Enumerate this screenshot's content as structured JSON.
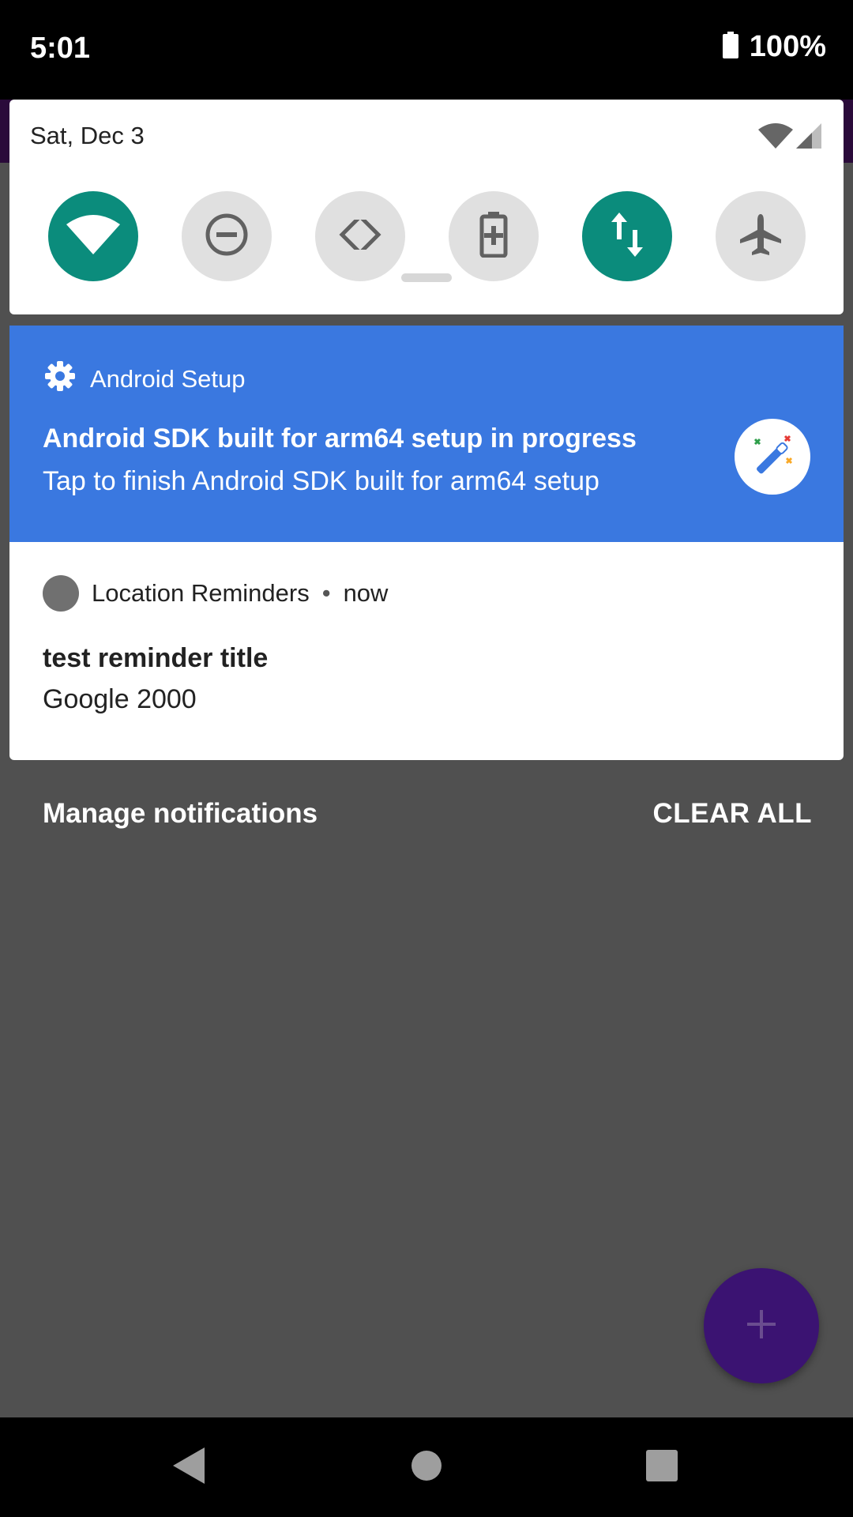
{
  "status_bar": {
    "time": "5:01",
    "battery_percent": "100%",
    "icons": [
      "battery-icon"
    ]
  },
  "quick_settings": {
    "date": "Sat, Dec 3",
    "status_icons": [
      "wifi-icon",
      "cell-signal-icon"
    ],
    "tiles": [
      {
        "name": "wifi",
        "icon": "wifi-icon",
        "active": true
      },
      {
        "name": "do-not-disturb",
        "icon": "do-not-disturb-icon",
        "active": false
      },
      {
        "name": "auto-rotate",
        "icon": "auto-rotate-icon",
        "active": false
      },
      {
        "name": "battery-saver",
        "icon": "battery-saver-icon",
        "active": false
      },
      {
        "name": "mobile-data",
        "icon": "mobile-data-icon",
        "active": true
      },
      {
        "name": "airplane-mode",
        "icon": "airplane-icon",
        "active": false
      }
    ],
    "colors": {
      "tile_on": "#0b8c7c",
      "tile_off": "#e0e0e0"
    }
  },
  "notifications": {
    "setup": {
      "app_name": "Android Setup",
      "title": "Android SDK built for arm64 setup in progress",
      "text": "Tap to finish Android SDK built for arm64 setup",
      "icon": "gear-icon",
      "avatar_icon": "magic-wand-icon",
      "background": "#3a78e0"
    },
    "reminder": {
      "app_name": "Location Reminders",
      "separator": "•",
      "time": "now",
      "title": "test reminder title",
      "text": "Google 2000"
    }
  },
  "footer": {
    "manage_label": "Manage notifications",
    "clear_all_label": "CLEAR ALL"
  },
  "fab": {
    "icon": "plus-icon",
    "color": "#3b1372"
  },
  "nav_bar": {
    "buttons": [
      "back-icon",
      "home-icon",
      "recents-icon"
    ]
  }
}
